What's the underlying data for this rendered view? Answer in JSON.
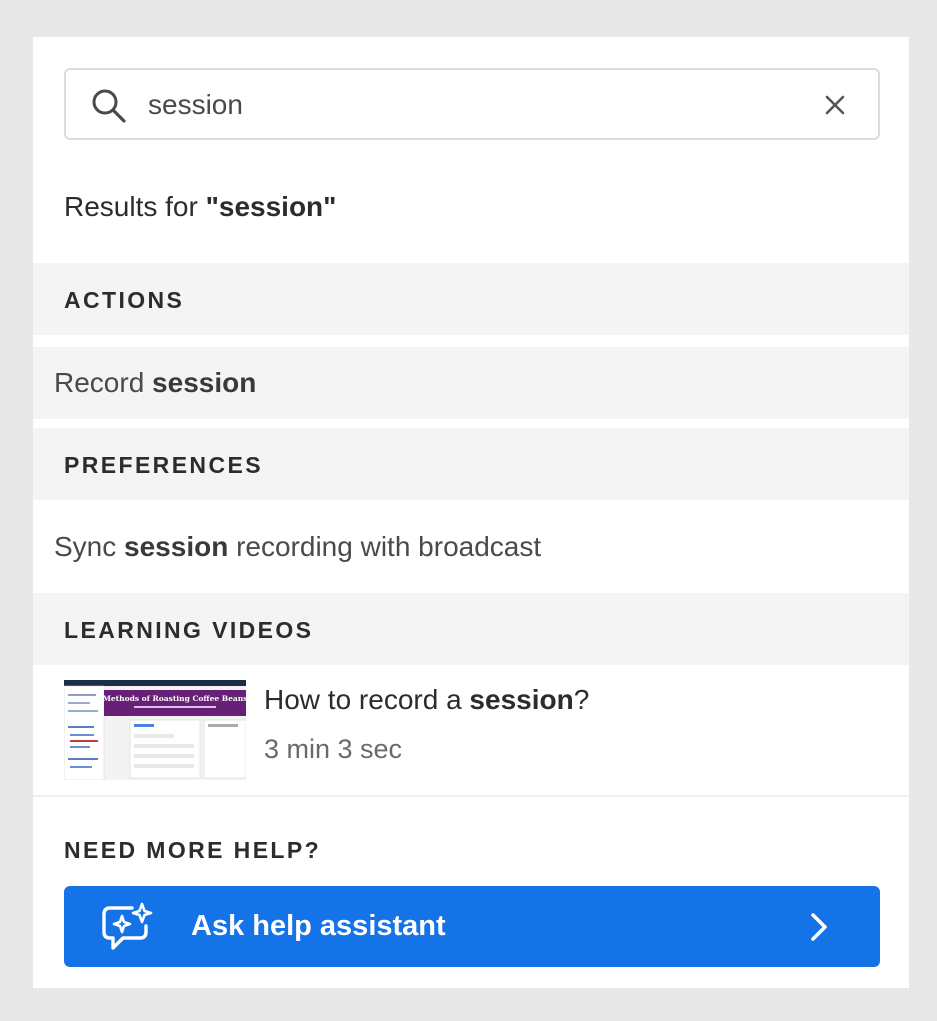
{
  "search": {
    "value": "session"
  },
  "results_header": {
    "prefix": "Results for ",
    "query_quoted": "\"session\""
  },
  "sections": {
    "actions": {
      "title": "ACTIONS",
      "items": [
        {
          "pre": "Record ",
          "match": "session",
          "post": ""
        }
      ]
    },
    "preferences": {
      "title": "PREFERENCES",
      "items": [
        {
          "pre": "Sync ",
          "match": "session",
          "post": " recording with broadcast"
        }
      ]
    },
    "learning_videos": {
      "title": "LEARNING VIDEOS",
      "items": [
        {
          "pre": "How to record a ",
          "match": "session",
          "post": "?",
          "duration": "3 min 3 sec",
          "thumbnail_title": "Methods of Roasting Coffee Beans"
        }
      ]
    }
  },
  "help": {
    "label": "NEED MORE HELP?",
    "button_label": "Ask help assistant"
  },
  "colors": {
    "accent": "#1473e6",
    "section_bg": "#f4f4f4",
    "text": "#2c2c2c"
  }
}
